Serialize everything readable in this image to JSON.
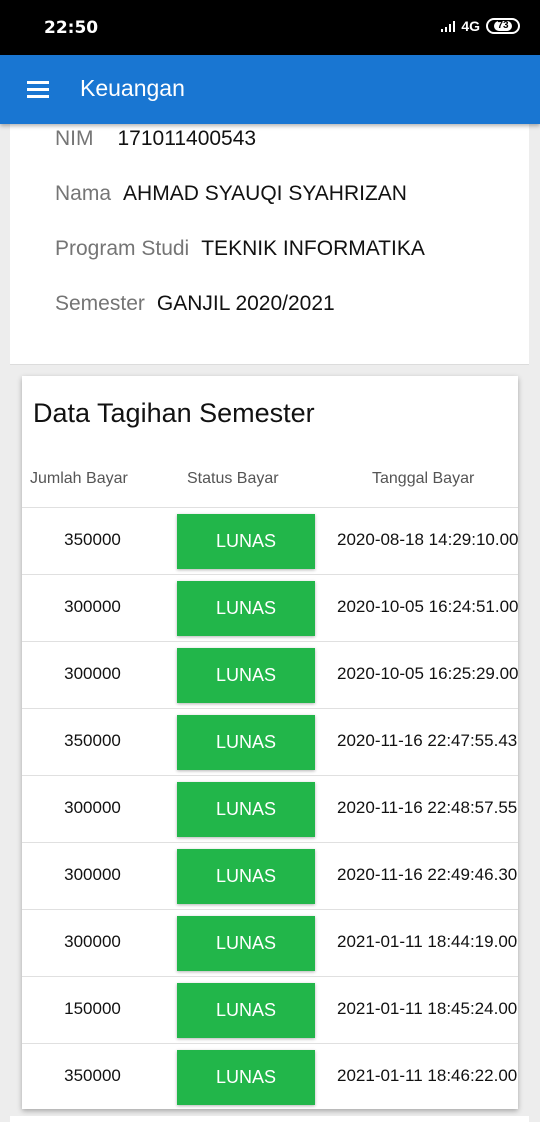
{
  "status_bar": {
    "time": "22:50",
    "network": "4G",
    "battery": "73"
  },
  "app_bar": {
    "title": "Keuangan"
  },
  "info": [
    {
      "label": "NIM",
      "value": "171011400543"
    },
    {
      "label": "Nama",
      "value": "AHMAD SYAUQI SYAHRIZAN"
    },
    {
      "label": "Program Studi",
      "value": "TEKNIK INFORMATIKA"
    },
    {
      "label": "Semester",
      "value": "GANJIL 2020/2021"
    }
  ],
  "table": {
    "title": "Data Tagihan Semester",
    "headers": [
      "Jumlah Bayar",
      "Status Bayar",
      "Tanggal Bayar"
    ],
    "rows": [
      {
        "amount": "350000",
        "status": "LUNAS",
        "date": "2020-08-18 14:29:10.00"
      },
      {
        "amount": "300000",
        "status": "LUNAS",
        "date": "2020-10-05 16:24:51.00"
      },
      {
        "amount": "300000",
        "status": "LUNAS",
        "date": "2020-10-05 16:25:29.00"
      },
      {
        "amount": "350000",
        "status": "LUNAS",
        "date": "2020-11-16 22:47:55.43"
      },
      {
        "amount": "300000",
        "status": "LUNAS",
        "date": "2020-11-16 22:48:57.55"
      },
      {
        "amount": "300000",
        "status": "LUNAS",
        "date": "2020-11-16 22:49:46.30"
      },
      {
        "amount": "300000",
        "status": "LUNAS",
        "date": "2021-01-11 18:44:19.00"
      },
      {
        "amount": "150000",
        "status": "LUNAS",
        "date": "2021-01-11 18:45:24.00"
      },
      {
        "amount": "350000",
        "status": "LUNAS",
        "date": "2021-01-11 18:46:22.00"
      }
    ]
  },
  "colors": {
    "app_bar": "#1976d2",
    "lunas_button": "#22b64a"
  },
  "icons": {
    "menu": "menu-icon",
    "signal": "signal-icon",
    "battery": "battery-icon"
  }
}
